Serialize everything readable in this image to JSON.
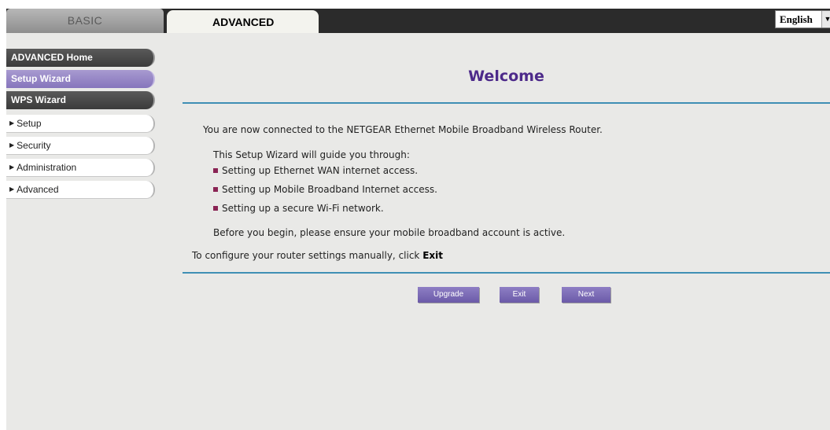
{
  "tabs": {
    "basic": "BASIC",
    "advanced": "ADVANCED"
  },
  "language": {
    "selected": "English",
    "arrow": "▼"
  },
  "sidebar": {
    "items": [
      {
        "label": "ADVANCED Home"
      },
      {
        "label": "Setup Wizard"
      },
      {
        "label": "WPS Wizard"
      },
      {
        "label": "Setup"
      },
      {
        "label": "Security"
      },
      {
        "label": "Administration"
      },
      {
        "label": "Advanced"
      }
    ],
    "triangle": "▶"
  },
  "main": {
    "title": "Welcome",
    "intro": "You are now connected to the NETGEAR Ethernet Mobile Broadband Wireless Router.",
    "guide": "This Setup Wizard will guide you through:",
    "steps": [
      "Setting up Ethernet WAN internet access.",
      "Setting up Mobile Broadband Internet access.",
      "Setting up a secure Wi-Fi network."
    ],
    "before": "Before you begin, please ensure your mobile broadband account is active.",
    "manual_prefix": "To configure your router settings manually, click ",
    "manual_exit": "Exit"
  },
  "buttons": {
    "upgrade": "Upgrade",
    "exit": "Exit",
    "next": "Next"
  },
  "colors": {
    "accent": "#4d2a8a",
    "rule": "#3f8fb4",
    "button": "#7a6ab6",
    "bullet": "#8a2454"
  }
}
